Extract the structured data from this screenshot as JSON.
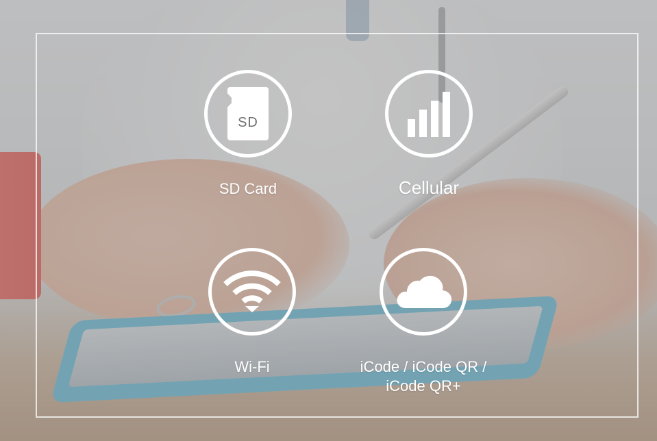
{
  "features": {
    "sd_card": {
      "label": "SD Card",
      "icon": "sd-card-icon",
      "icon_text": "SD"
    },
    "cellular": {
      "label": "Cellular",
      "icon": "signal-bars-icon"
    },
    "wifi": {
      "label": "Wi-Fi",
      "icon": "wifi-icon"
    },
    "icode": {
      "label_line1": "iCode / iCode QR /",
      "label_line2": "iCode QR+",
      "icon": "cloud-icon"
    }
  },
  "colors": {
    "icon_color": "#ffffff",
    "overlay": "#969696"
  }
}
